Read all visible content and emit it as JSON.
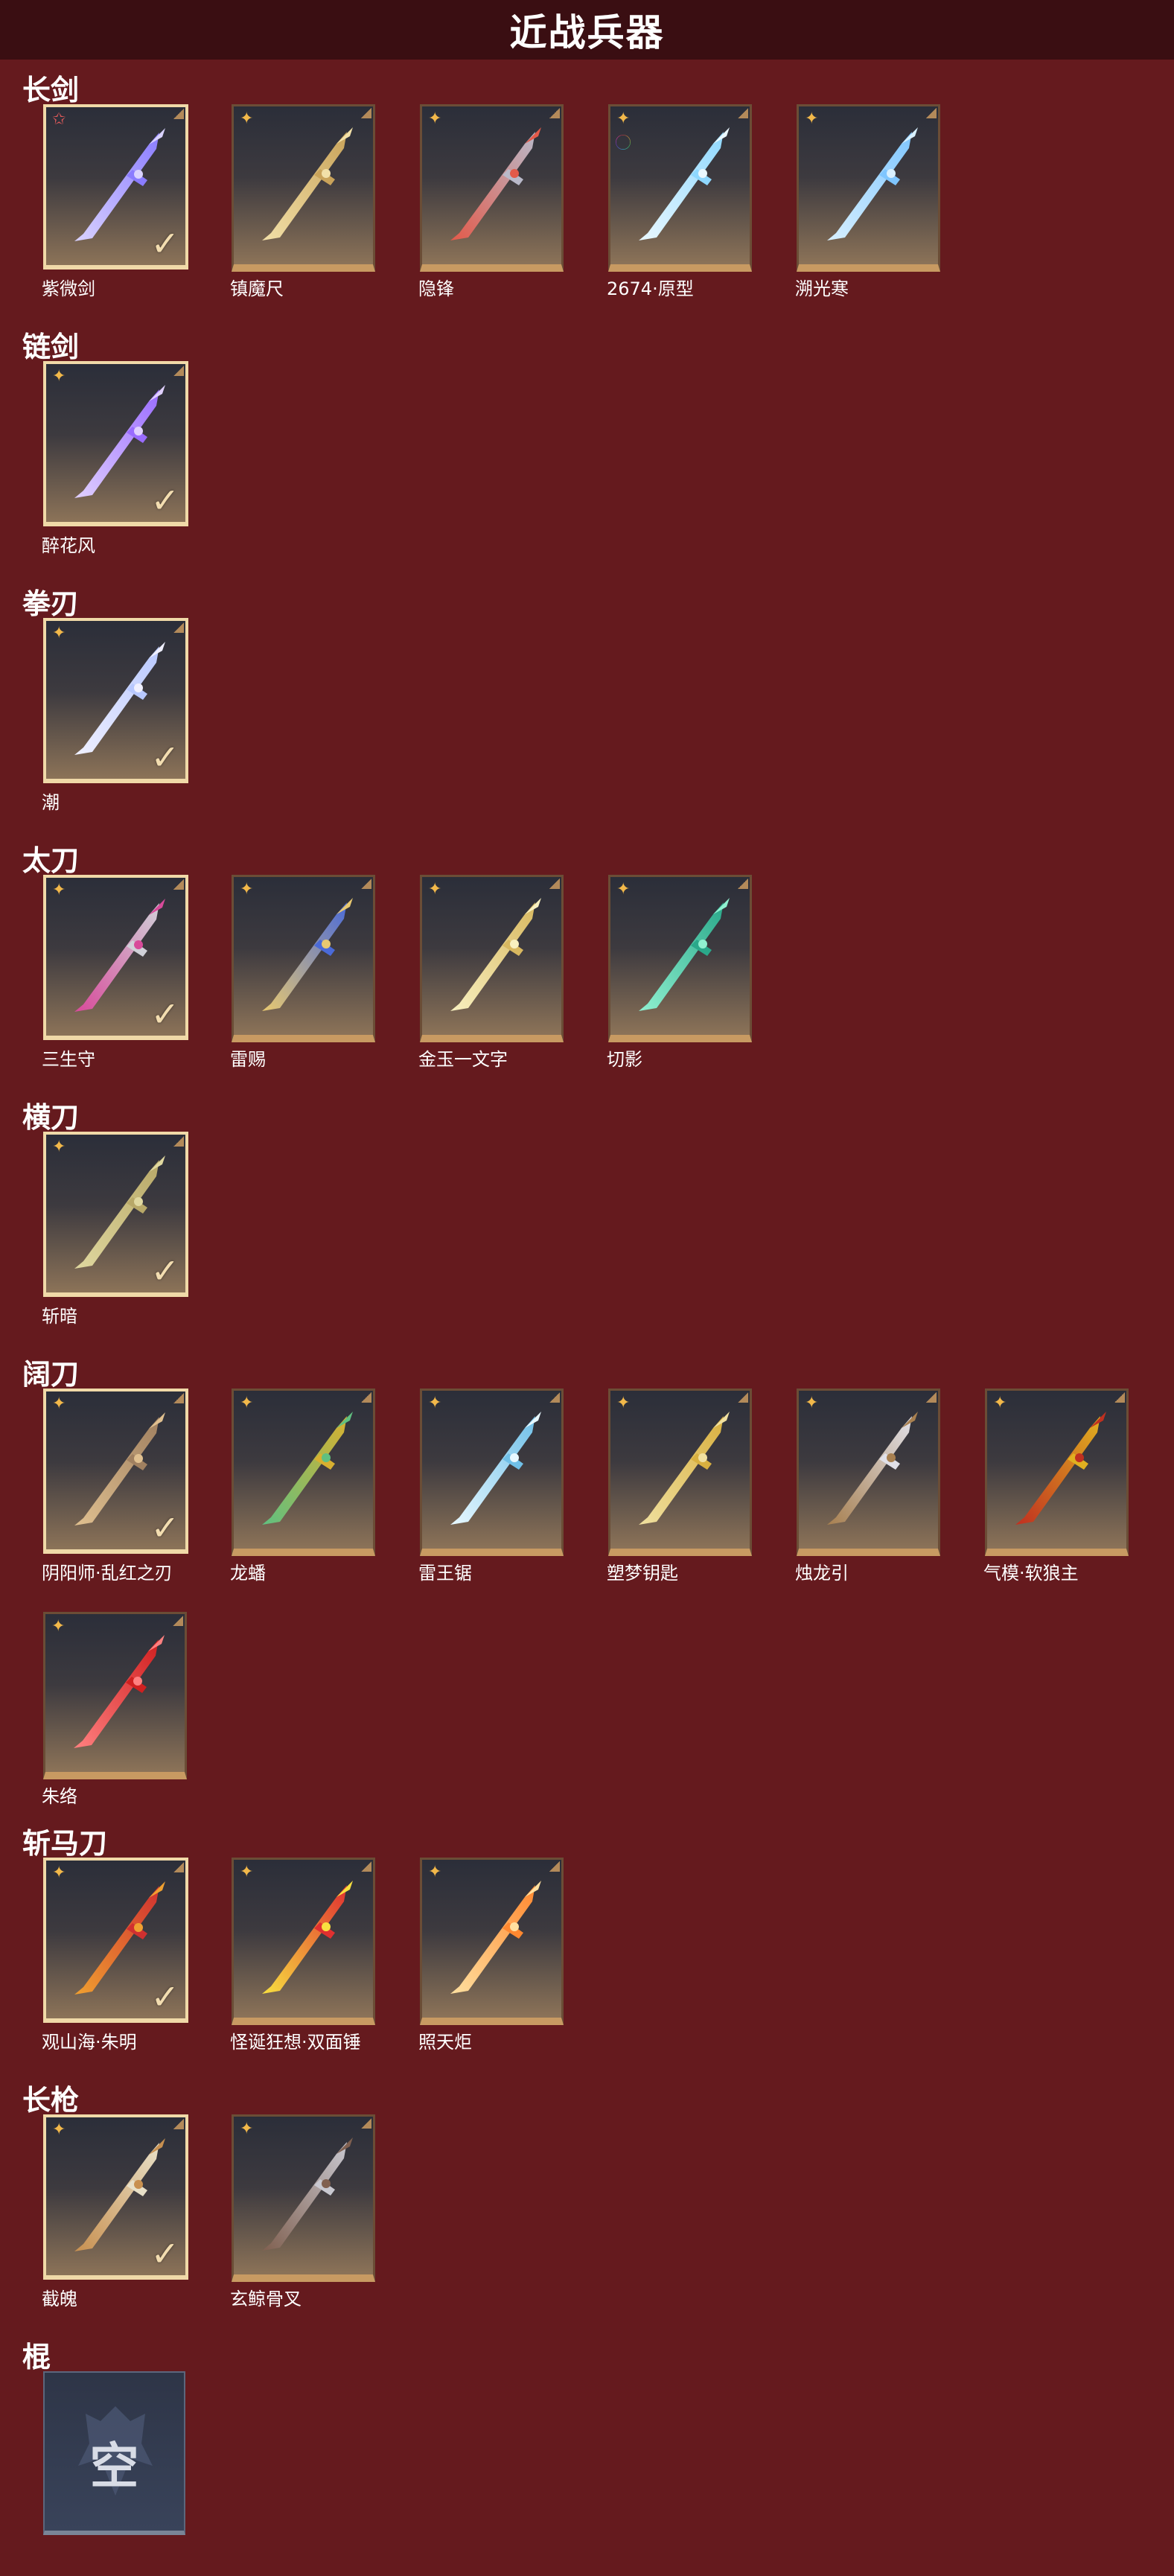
{
  "header": {
    "title": "近战兵器"
  },
  "sections": [
    {
      "title": "长剑",
      "items": [
        {
          "name": "紫微剑",
          "selected": true,
          "badge": "star"
        },
        {
          "name": "镇魔尺",
          "selected": false,
          "badge": "cross"
        },
        {
          "name": "隐锋",
          "selected": false,
          "badge": "cross"
        },
        {
          "name": "2674·原型",
          "selected": false,
          "badge": "cross-ring"
        },
        {
          "name": "溯光寒",
          "selected": false,
          "badge": "cross"
        }
      ]
    },
    {
      "title": "链剑",
      "items": [
        {
          "name": "醉花风",
          "selected": true,
          "badge": "cross"
        }
      ]
    },
    {
      "title": "拳刃",
      "items": [
        {
          "name": "潮",
          "selected": true,
          "badge": "cross"
        }
      ]
    },
    {
      "title": "太刀",
      "items": [
        {
          "name": "三生守",
          "selected": true,
          "badge": "cross"
        },
        {
          "name": "雷赐",
          "selected": false,
          "badge": "cross"
        },
        {
          "name": "金玉一文字",
          "selected": false,
          "badge": "cross"
        },
        {
          "name": "切影",
          "selected": false,
          "badge": "cross"
        }
      ]
    },
    {
      "title": "横刀",
      "items": [
        {
          "name": "斩暗",
          "selected": true,
          "badge": "cross"
        }
      ]
    },
    {
      "title": "阔刀",
      "items": [
        {
          "name": "阴阳师·乱红之刃",
          "selected": true,
          "badge": "cross"
        },
        {
          "name": "龙蟠",
          "selected": false,
          "badge": "cross"
        },
        {
          "name": "雷王锯",
          "selected": false,
          "badge": "cross"
        },
        {
          "name": "塑梦钥匙",
          "selected": false,
          "badge": "cross"
        },
        {
          "name": "烛龙引",
          "selected": false,
          "badge": "cross"
        },
        {
          "name": "气模·软狼主",
          "selected": false,
          "badge": "cross"
        },
        {
          "name": "朱络",
          "selected": false,
          "badge": "cross"
        }
      ]
    },
    {
      "title": "斩马刀",
      "items": [
        {
          "name": "观山海·朱明",
          "selected": true,
          "badge": "cross"
        },
        {
          "name": "怪诞狂想·双面锤",
          "selected": false,
          "badge": "cross"
        },
        {
          "name": "照天炬",
          "selected": false,
          "badge": "cross"
        }
      ]
    },
    {
      "title": "长枪",
      "items": [
        {
          "name": "截魄",
          "selected": true,
          "badge": "cross"
        },
        {
          "name": "玄鲸骨叉",
          "selected": false,
          "badge": "cross"
        }
      ]
    },
    {
      "title": "棍",
      "items": [
        {
          "name": "",
          "selected": false,
          "badge": "none",
          "empty_label": "空"
        }
      ]
    }
  ],
  "colors": {
    "background": "#651a1e",
    "header": "#3a0e12",
    "tile_border": "#c89a62",
    "selected_border": "#f0d9a8",
    "badge": "#f2b84a"
  },
  "icons": {
    "badge": "cross-sparkle-icon",
    "check": "checkmark-icon",
    "empty": "empty-slot-icon"
  }
}
